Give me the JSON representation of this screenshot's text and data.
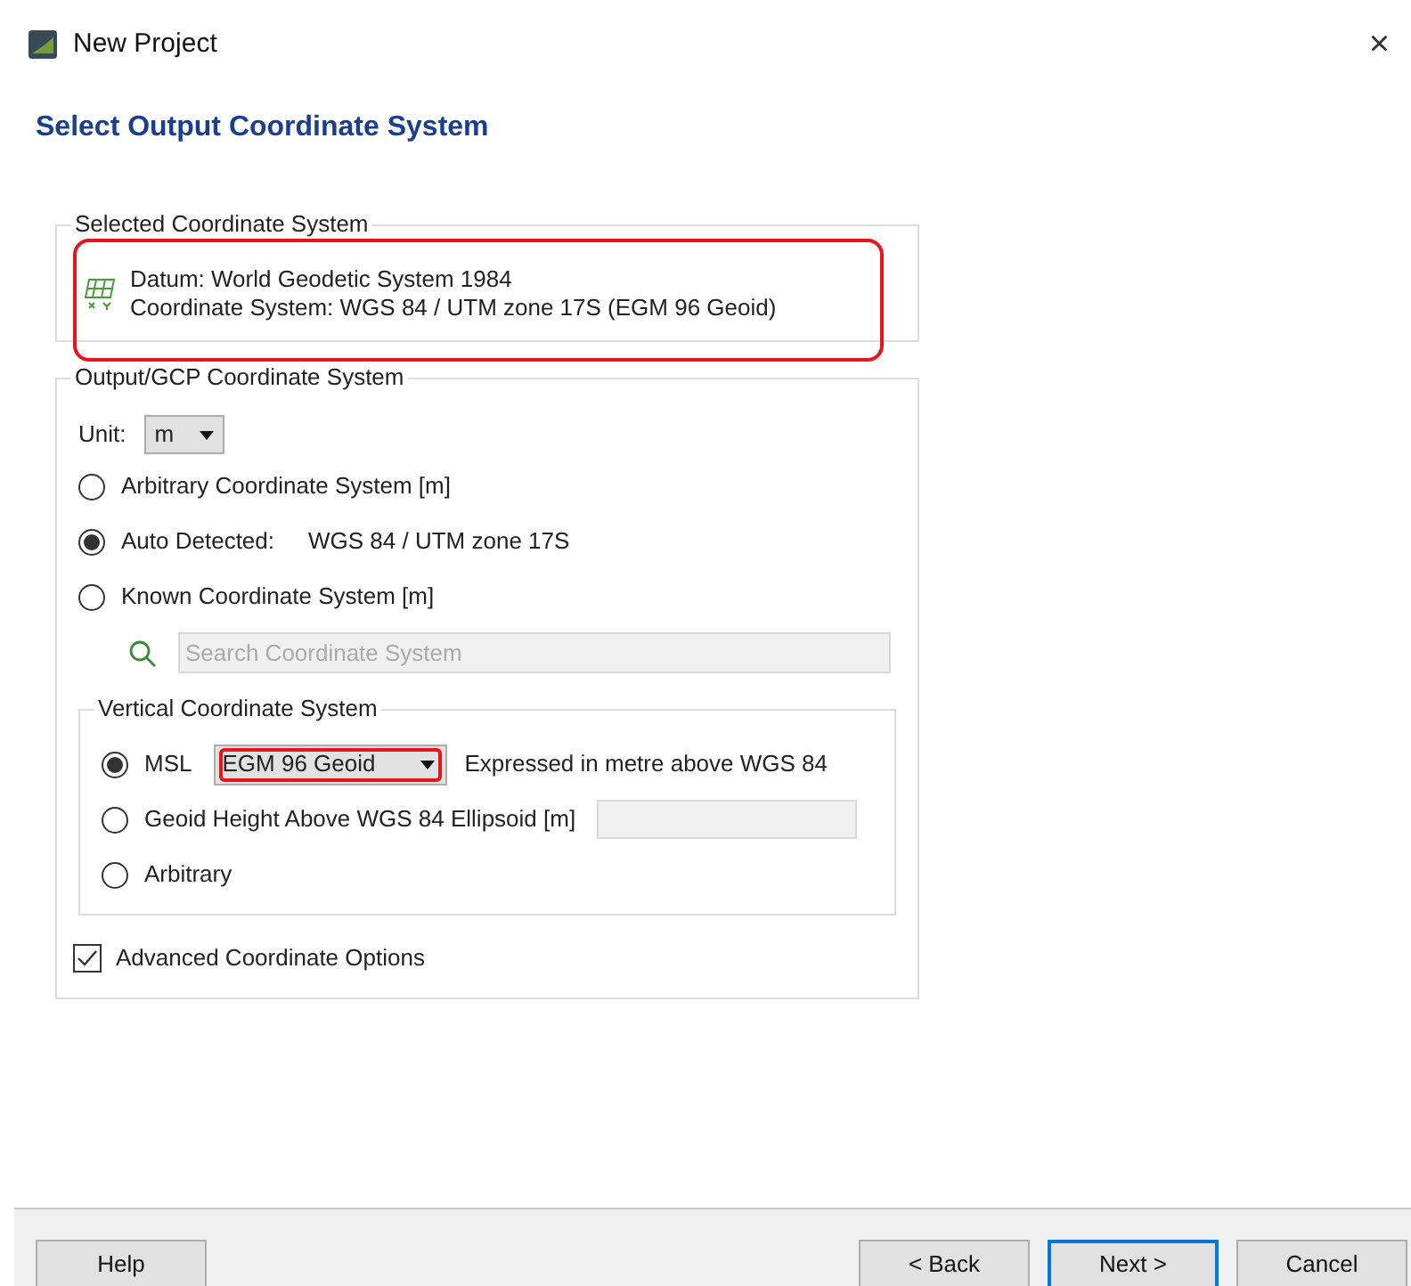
{
  "window": {
    "title": "New Project",
    "close": "×"
  },
  "heading": "Select Output Coordinate System",
  "selected_system": {
    "legend": "Selected Coordinate System",
    "highlighted": true,
    "lines": [
      "Datum: World Geodetic System 1984",
      "Coordinate System: WGS 84 / UTM zone 17S (EGM 96 Geoid)"
    ]
  },
  "output_system": {
    "legend": "Output/GCP Coordinate System",
    "unit_label": "Unit:",
    "unit_value": "m",
    "options": [
      {
        "label": "Arbitrary Coordinate System [m]",
        "selected": false
      },
      {
        "label": "Auto Detected:",
        "detail": "WGS 84 / UTM zone 17S",
        "selected": true
      },
      {
        "label": "Known Coordinate System [m]",
        "selected": false
      }
    ],
    "search": {
      "placeholder": "Search Coordinate System"
    },
    "vertical": {
      "legend": "Vertical Coordinate System",
      "options": [
        {
          "kind": "dropdown",
          "label": "MSL",
          "selected": true,
          "value": "EGM 96 Geoid",
          "highlighted": true,
          "note": "Expressed in metre above WGS 84"
        },
        {
          "kind": "field",
          "label": "Geoid Height Above WGS 84 Ellipsoid [m]",
          "selected": false
        },
        {
          "kind": "plain",
          "label": "Arbitrary",
          "selected": false
        }
      ]
    },
    "advanced": {
      "label": "Advanced Coordinate Options",
      "checked": true
    }
  },
  "buttons": [
    {
      "label": "Help",
      "kind": "left",
      "focused": false
    },
    {
      "label": "< Back",
      "kind": "right",
      "focused": false
    },
    {
      "label": "Next >",
      "kind": "right",
      "focused": true
    },
    {
      "label": "Cancel",
      "kind": "right",
      "focused": false
    }
  ]
}
